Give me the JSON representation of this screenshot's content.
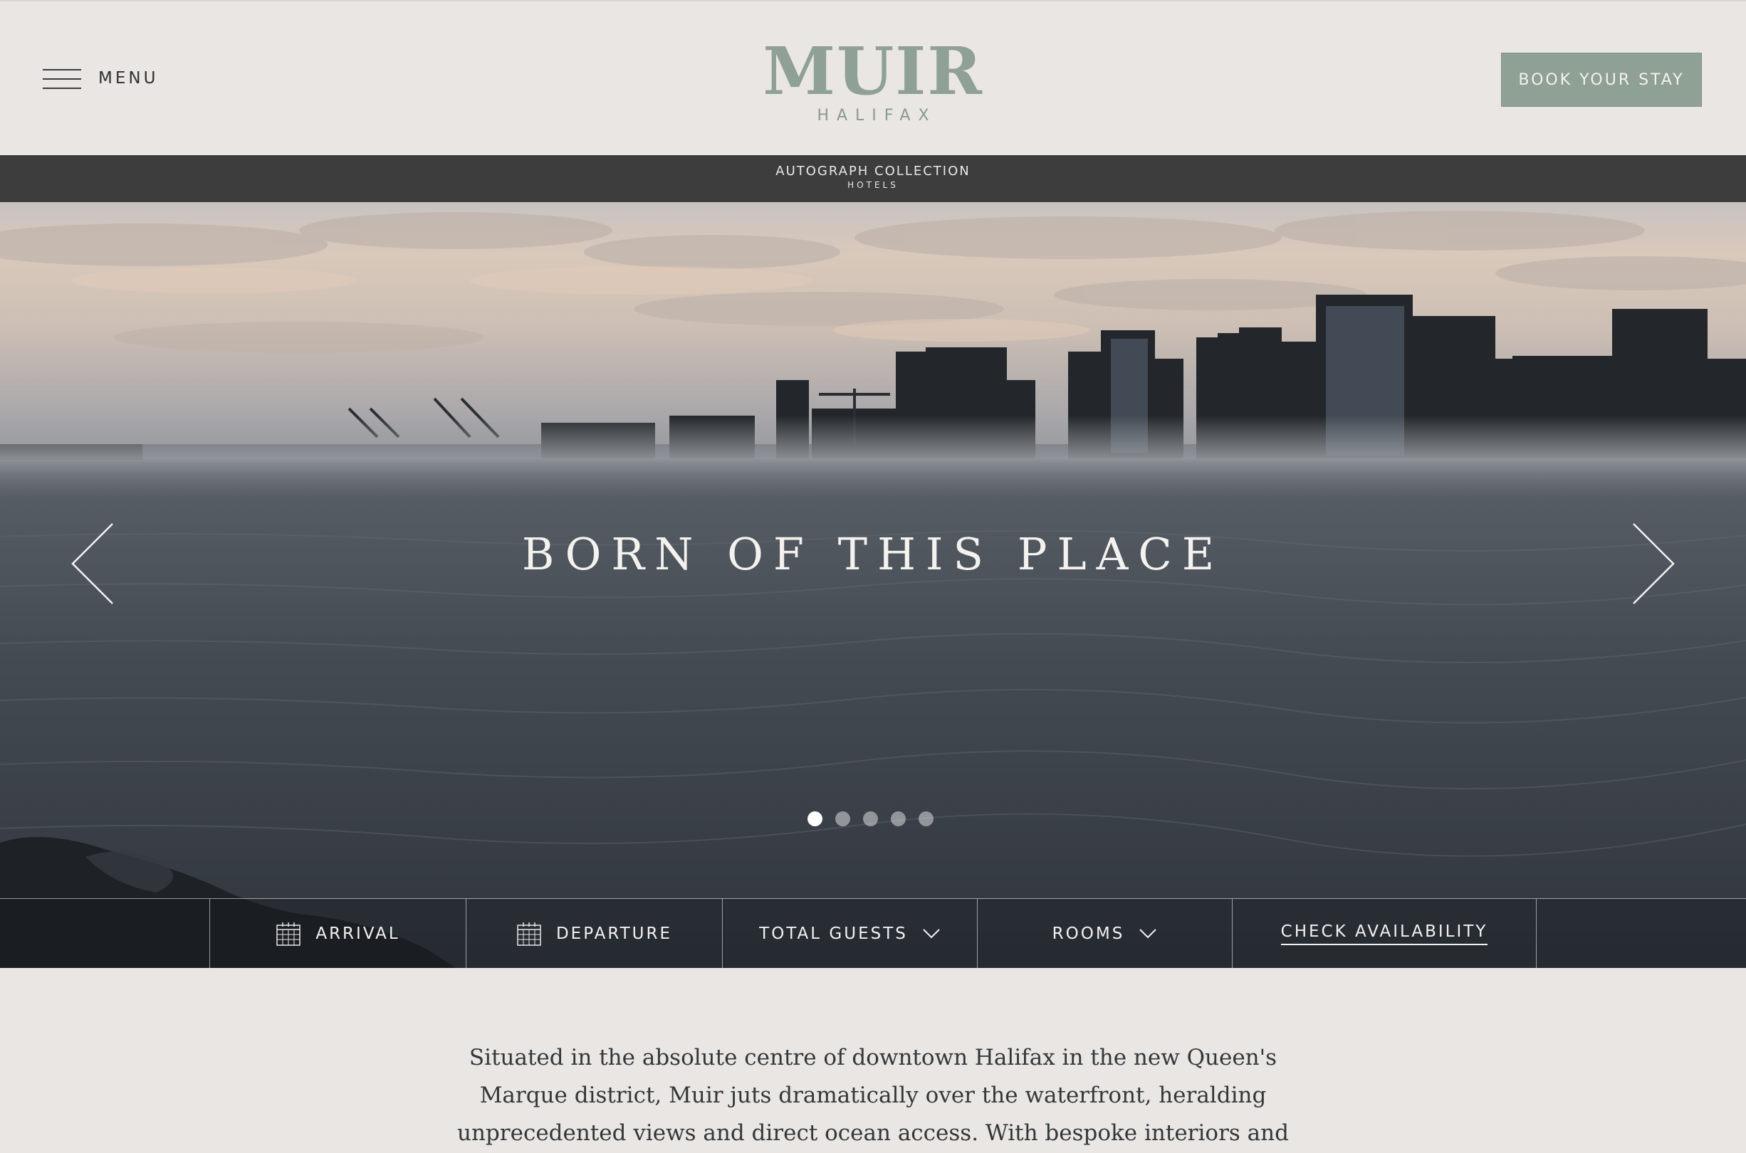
{
  "header": {
    "menu_label": "MENU",
    "logo": {
      "main": "MUIR",
      "sub": "HALIFAX"
    },
    "book_label": "BOOK YOUR STAY"
  },
  "collection_bar": {
    "line1": "AUTOGRAPH COLLECTION",
    "line2": "HOTELS"
  },
  "hero": {
    "title": "BORN OF THIS PLACE",
    "slide_count": 5,
    "active_slide": 1
  },
  "booking": {
    "arrival_label": "ARRIVAL",
    "departure_label": "DEPARTURE",
    "guests_label": "TOTAL GUESTS",
    "rooms_label": "ROOMS",
    "check_label": "CHECK AVAILABILITY"
  },
  "intro": {
    "text": "Situated in the absolute centre of downtown Halifax in the new Queen's Marque district, Muir juts dramatically over the waterfront, heralding unprecedented views and direct ocean access. With bespoke interiors and furniture, ultra-premium fitness and vitality centre, exclusive guest-only art"
  },
  "colors": {
    "sage": "#8fa095",
    "background": "#e9e6e3",
    "bar": "#3d3d3d"
  },
  "icons": {
    "menu": "hamburger-icon",
    "prev": "chevron-left-icon",
    "next": "chevron-right-icon",
    "calendar": "calendar-icon",
    "dropdown": "chevron-down-icon"
  }
}
